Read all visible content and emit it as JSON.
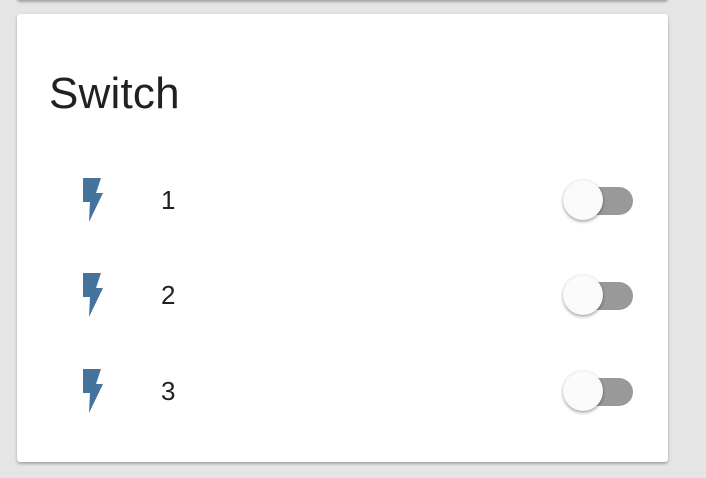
{
  "card": {
    "title": "Switch"
  },
  "switches": [
    {
      "label": "1",
      "icon": "flash-icon",
      "state": "off"
    },
    {
      "label": "2",
      "icon": "flash-icon",
      "state": "off"
    },
    {
      "label": "3",
      "icon": "flash-icon",
      "state": "off"
    }
  ],
  "colors": {
    "icon": "#44739e",
    "track_off": "#999999",
    "knob_off": "#fafafa",
    "text": "#212121",
    "background": "#e5e5e5",
    "card": "#ffffff"
  }
}
